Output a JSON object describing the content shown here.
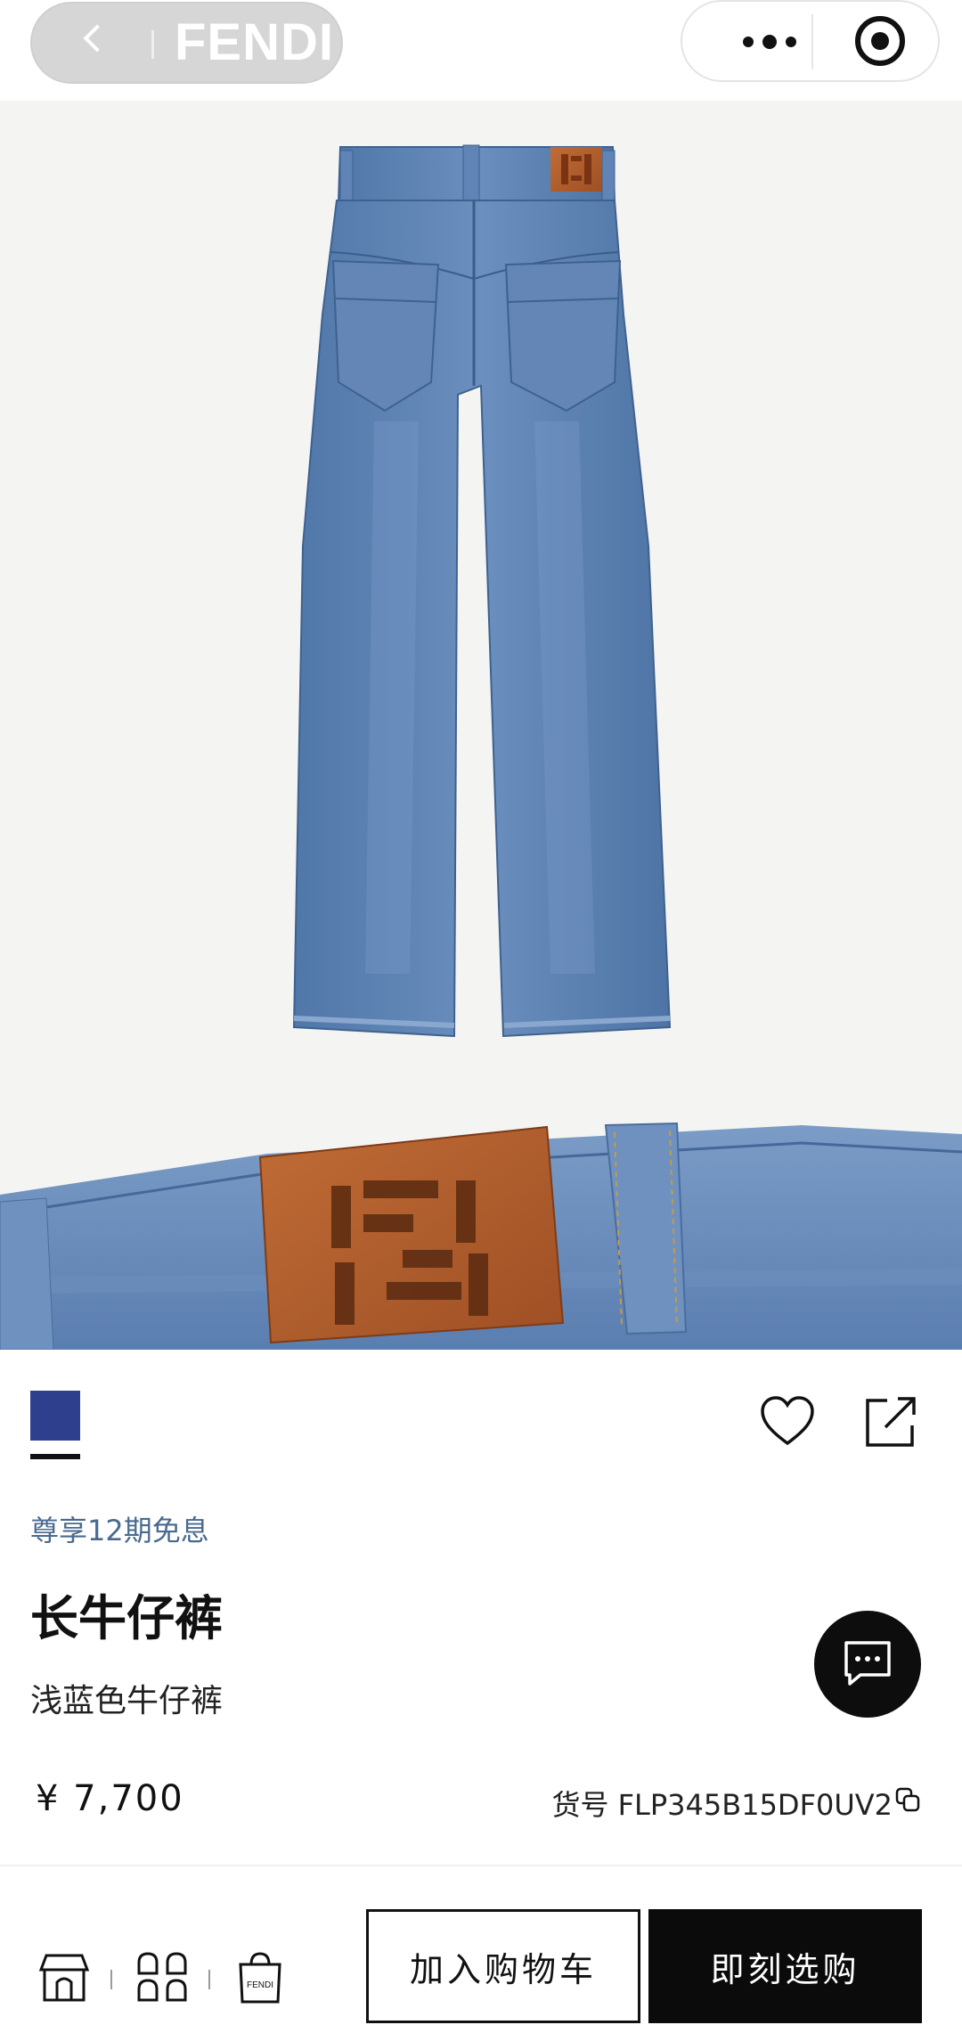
{
  "header": {
    "brand": "FENDI"
  },
  "product": {
    "installment_note": "尊享12期免息",
    "title": "长牛仔裤",
    "subtitle": "浅蓝色牛仔裤",
    "price": "¥ 7,700",
    "sku_label": "货号",
    "sku_value": "FLP345B15DF0UV2",
    "selected_color_hex": "#2e3f8e"
  },
  "actions": {
    "add_to_cart": "加入购物车",
    "buy_now": "即刻选购"
  },
  "bottom_nav": {
    "icons": [
      "store-icon",
      "categories-icon",
      "shopping-bag-icon"
    ],
    "bag_logo_text": "FENDI"
  },
  "colors": {
    "accent_text": "#4a6a8e",
    "primary_button": "#0b0b0b",
    "denim": "#5a7fae",
    "leather_patch": "#b4602f"
  }
}
